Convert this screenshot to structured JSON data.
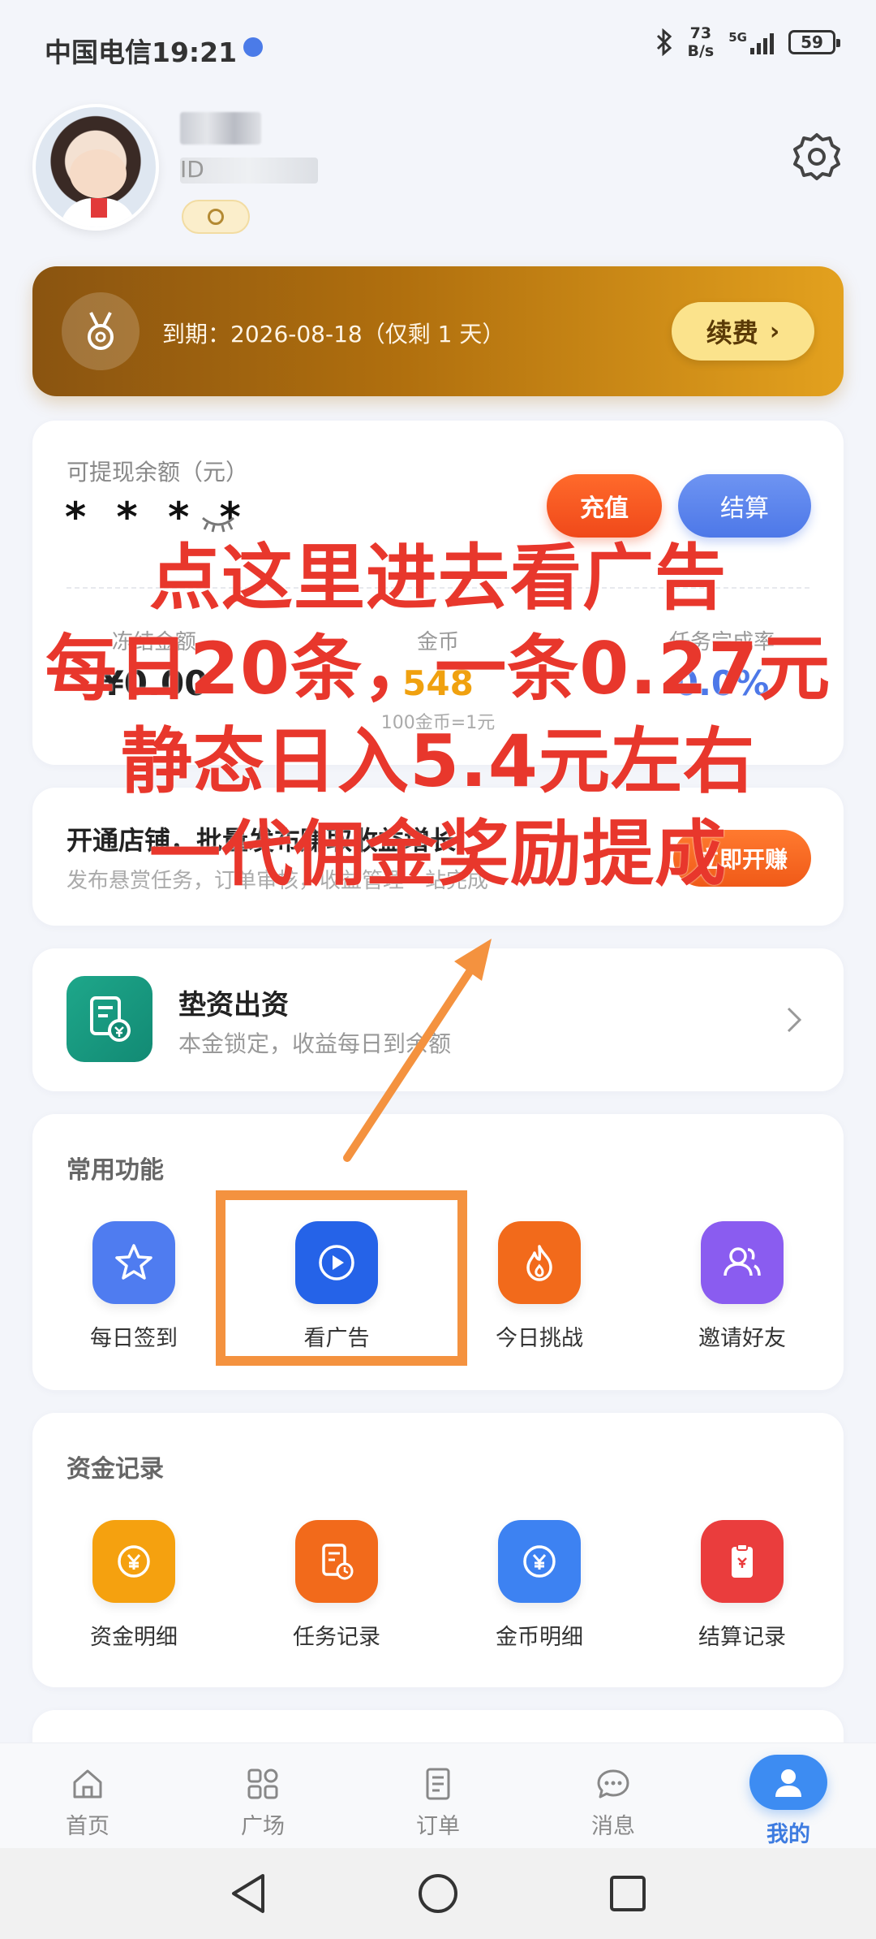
{
  "status_bar": {
    "carrier_time": "中国电信19:21",
    "net_speed_value": "73",
    "net_speed_unit": "B/s",
    "network": "5G",
    "battery": "59"
  },
  "profile": {
    "id_prefix": "ID"
  },
  "membership": {
    "expiry_text": "到期：2026-08-18（仅剩 1 天）",
    "renew_label": "续费"
  },
  "balance": {
    "title": "可提现余额（元）",
    "masked_value": "* * * *",
    "recharge_label": "充值",
    "settle_label": "结算",
    "stats": [
      {
        "label": "冻结金额",
        "value": "¥0.00",
        "sub": ""
      },
      {
        "label": "金币",
        "value": "548",
        "sub": "100金币=1元"
      },
      {
        "label": "任务完成率",
        "value": "0.0%",
        "sub": ""
      }
    ]
  },
  "shop": {
    "title": "开通店铺，批量发布赚取收益增长",
    "desc": "发布悬赏任务，订单审核，收益管理一站完成",
    "button": "立即开赚"
  },
  "advance": {
    "title": "垫资出资",
    "desc": "本金锁定，收益每日到余额"
  },
  "common_functions": {
    "title": "常用功能",
    "items": [
      {
        "label": "每日签到",
        "color": "#4f7cf0"
      },
      {
        "label": "看广告",
        "color": "#2563e8"
      },
      {
        "label": "今日挑战",
        "color": "#f26a1b"
      },
      {
        "label": "邀请好友",
        "color": "#8a5cf0"
      }
    ]
  },
  "fund_records": {
    "title": "资金记录",
    "items": [
      {
        "label": "资金明细",
        "color": "#f5a10f"
      },
      {
        "label": "任务记录",
        "color": "#f26a1b"
      },
      {
        "label": "金币明细",
        "color": "#3d82f2"
      },
      {
        "label": "结算记录",
        "color": "#ea3d3d"
      }
    ]
  },
  "bottom_nav": [
    {
      "label": "首页"
    },
    {
      "label": "广场"
    },
    {
      "label": "订单"
    },
    {
      "label": "消息"
    },
    {
      "label": "我的"
    }
  ],
  "annotation": {
    "line1": "点这里进去看广告",
    "line2": "每日20条，一条0.27元",
    "line3": "静态日入5.4元左右",
    "line4": "一代佣金奖励提成",
    "color": "#e8372c",
    "arrow_color": "#f4923f"
  }
}
